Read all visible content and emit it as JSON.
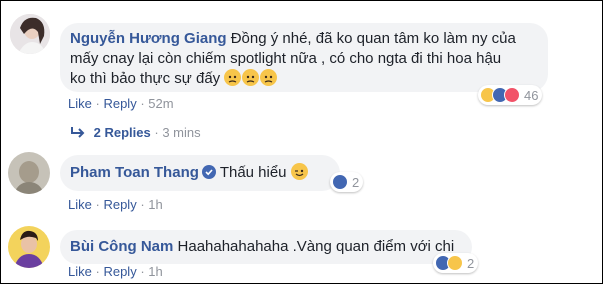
{
  "comments": [
    {
      "name": "Nguyễn Hương Giang",
      "text_line1": "Đồng ý nhé, đã ko quan tâm ko làm ny của",
      "text_line2": "mấy cnay lại còn chiếm spotlight nữa , có cho ngta đi thi hoa hậu",
      "text_line3": "ko thì bảo thực sự đấy",
      "like_label": "Like",
      "reply_label": "Reply",
      "time": "52m",
      "reaction_count": "46",
      "replies_label": "2 Replies",
      "replies_time": "3 mins"
    },
    {
      "name": "Pham Toan Thang",
      "text": "Thấu hiểu",
      "like_label": "Like",
      "reply_label": "Reply",
      "time": "1h",
      "reaction_count": "2"
    },
    {
      "name": "Bùi Công Nam",
      "text": "Haahahahahaha .Vàng quan điểm với chi",
      "like_label": "Like",
      "reply_label": "Reply",
      "time": "1h",
      "reaction_count": "2"
    }
  ],
  "separator": "·",
  "colors": {
    "link": "#365899",
    "bubble": "#f2f3f5",
    "like": "#4267b2",
    "haha": "#f7c54a",
    "love": "#f25268"
  }
}
